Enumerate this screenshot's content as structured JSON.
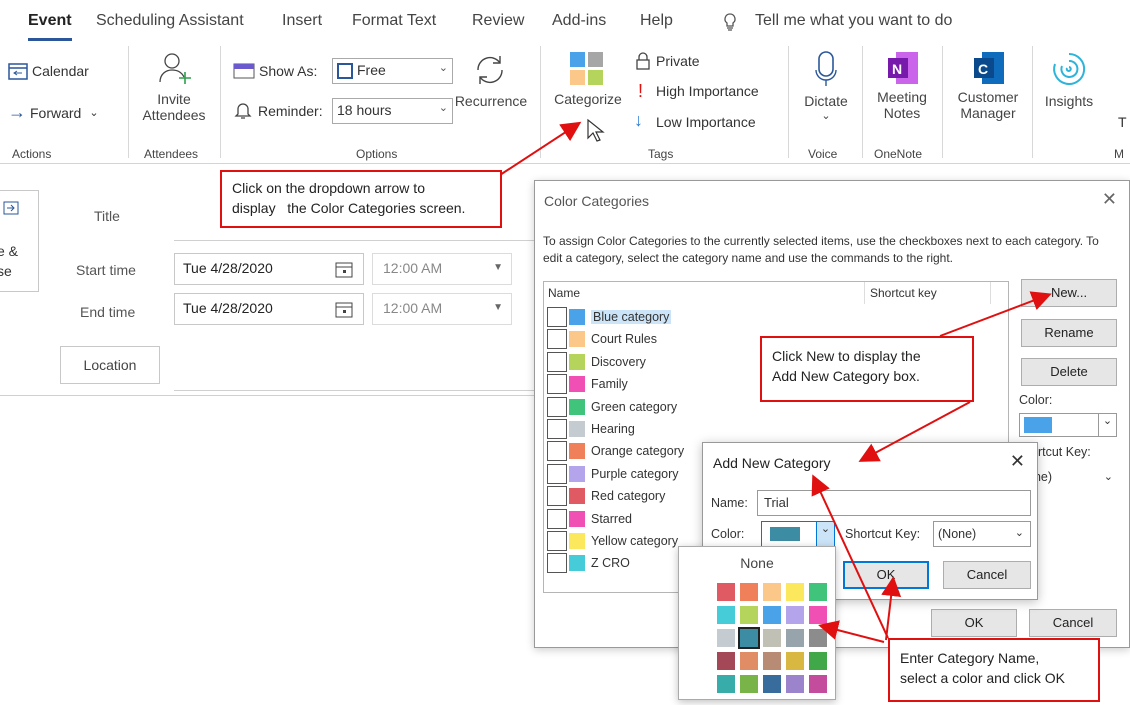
{
  "tabs": [
    "Event",
    "Scheduling Assistant",
    "Insert",
    "Format Text",
    "Review",
    "Add-ins",
    "Help"
  ],
  "tell_me": "Tell me what you want to do",
  "ribbon": {
    "actions": {
      "calendar": "Calendar",
      "forward": "Forward",
      "label": "Actions"
    },
    "attendees": {
      "invite_1": "Invite",
      "invite_2": "Attendees",
      "label": "Attendees"
    },
    "options": {
      "show_as_label": "Show As:",
      "show_as_value": "Free",
      "reminder_label": "Reminder:",
      "reminder_value": "18 hours",
      "recurrence": "Recurrence",
      "label": "Options"
    },
    "tags": {
      "categorize": "Categorize",
      "private": "Private",
      "high": "High Importance",
      "low": "Low Importance",
      "label": "Tags"
    },
    "voice": {
      "dictate": "Dictate",
      "label": "Voice"
    },
    "onenote": {
      "meeting_1": "Meeting",
      "meeting_2": "Notes",
      "label": "OneNote"
    },
    "customer": {
      "l1": "Customer",
      "l2": "Manager"
    },
    "insights": "Insights",
    "cut_t": "T",
    "cut_m": "M"
  },
  "form": {
    "left_1": "e &",
    "left_2": "se",
    "title_label": "Title",
    "start_label": "Start time",
    "end_label": "End time",
    "start_date": "Tue 4/28/2020",
    "end_date": "Tue 4/28/2020",
    "start_time": "12:00 AM",
    "end_time": "12:00 AM",
    "location": "Location"
  },
  "callouts": {
    "dropdown_1": "Click on the dropdown arrow to",
    "dropdown_2": "display   the Color Categories screen.",
    "new_1": "Click New to display the",
    "new_2": "Add New Category box.",
    "enter_1": "Enter Category Name,",
    "enter_2": "select a color and click OK"
  },
  "color_dialog": {
    "title": "Color Categories",
    "instructions": "To assign Color Categories to the currently selected items, use the checkboxes next to each category.  To edit a category, select the category name and use the commands to the right.",
    "col_name": "Name",
    "col_shortcut": "Shortcut key",
    "categories": [
      {
        "name": "Blue category",
        "color": "#4aa3e8"
      },
      {
        "name": "Court Rules",
        "color": "#fcc88a"
      },
      {
        "name": "Discovery",
        "color": "#b5d45c"
      },
      {
        "name": "Family",
        "color": "#f050b4"
      },
      {
        "name": "Green category",
        "color": "#40c47c"
      },
      {
        "name": "Hearing",
        "color": "#c4ccd2"
      },
      {
        "name": "Orange category",
        "color": "#f0805a"
      },
      {
        "name": "Purple category",
        "color": "#b4a4ec"
      },
      {
        "name": "Red category",
        "color": "#e05a64"
      },
      {
        "name": "Starred",
        "color": "#f050b4"
      },
      {
        "name": "Yellow category",
        "color": "#fce85c"
      },
      {
        "name": "Z CRO",
        "color": "#46ccd8"
      }
    ],
    "new": "New...",
    "rename": "Rename",
    "delete": "Delete",
    "color_label": "Color:",
    "color_value": "#4aa3e8",
    "shortcut_label": "ortcut Key:",
    "shortcut_value": "one)",
    "ok": "OK",
    "cancel": "Cancel"
  },
  "add_dialog": {
    "title": "Add New Category",
    "name_label": "Name:",
    "name_value": "Trial",
    "color_label": "Color:",
    "color_value": "#3c8ca4",
    "shortcut_label": "Shortcut Key:",
    "shortcut_value": "(None)",
    "ok": "OK",
    "cancel": "Cancel"
  },
  "palette": {
    "none": "None",
    "rows": [
      [
        "#e05a64",
        "#f0805a",
        "#fcc88a",
        "#fce85c",
        "#40c47c"
      ],
      [
        "#46ccd8",
        "#b5d45c",
        "#4aa3e8",
        "#b4a4ec",
        "#f050b4"
      ],
      [
        "#c4ccd2",
        "#3c8ca4",
        "#c0c0b4",
        "#98a4ac",
        "#8c8c8c"
      ],
      [
        "#a44858",
        "#e08c64",
        "#b88c74",
        "#d8b840",
        "#40a848"
      ],
      [
        "#38aca8",
        "#78b448",
        "#386c9c",
        "#9c84cc",
        "#c44c9c"
      ]
    ]
  }
}
